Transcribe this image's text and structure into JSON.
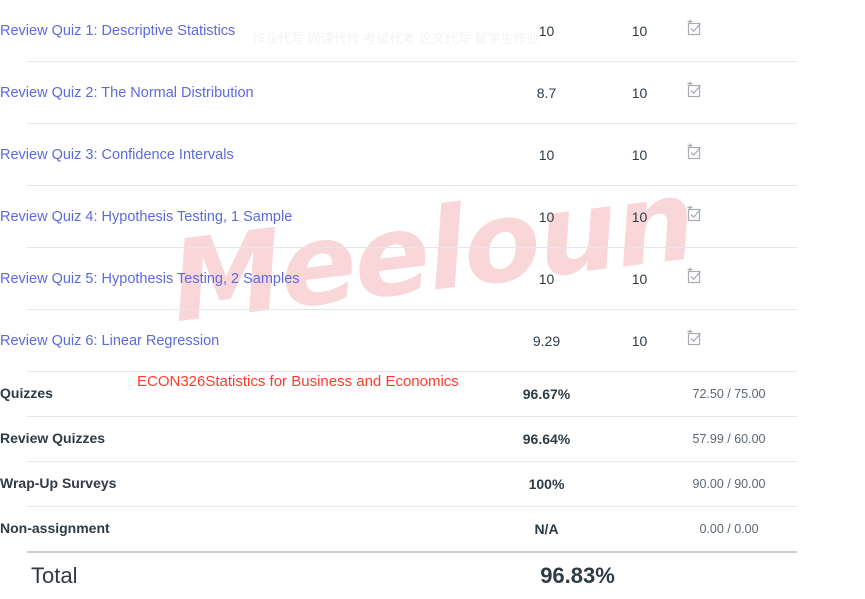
{
  "watermarks": {
    "brand": "Meeloun",
    "brand_color": "#f9d7d9",
    "course": "ECON326Statistics for Business and Economics",
    "course_color": "#ff3b30",
    "ghost": "作业代写 网课代修 考试代考 论文代写 留学生作业"
  },
  "theme": {
    "link_color": "#5b6ae0",
    "text_color": "#2d3b45",
    "muted_color": "#5b6871",
    "separator_color": "#e3e6ea",
    "total_separator_color": "#c7cdd1"
  },
  "icons": {
    "rubric": "rubric-checkbox-icon"
  },
  "assignments": [
    {
      "name": "Review Quiz 1: Descriptive Statistics",
      "score": "10",
      "points": "10",
      "icon": "rubric-checkbox-icon"
    },
    {
      "name": "Review Quiz 2: The Normal Distribution",
      "score": "8.7",
      "points": "10",
      "icon": "rubric-checkbox-icon"
    },
    {
      "name": "Review Quiz 3: Confidence Intervals",
      "score": "10",
      "points": "10",
      "icon": "rubric-checkbox-icon"
    },
    {
      "name": "Review Quiz 4: Hypothesis Testing, 1 Sample",
      "score": "10",
      "points": "10",
      "icon": "rubric-checkbox-icon"
    },
    {
      "name": "Review Quiz 5: Hypothesis Testing, 2 Samples",
      "score": "10",
      "points": "10",
      "icon": "rubric-checkbox-icon"
    },
    {
      "name": "Review Quiz 6: Linear Regression",
      "score": "9.29",
      "points": "10",
      "icon": "rubric-checkbox-icon"
    }
  ],
  "groups": [
    {
      "name": "Quizzes",
      "percent": "96.67%",
      "fraction": "72.50 / 75.00"
    },
    {
      "name": "Review Quizzes",
      "percent": "96.64%",
      "fraction": "57.99 / 60.00"
    },
    {
      "name": "Wrap-Up Surveys",
      "percent": "100%",
      "fraction": "90.00 / 90.00"
    },
    {
      "name": "Non-assignment",
      "percent": "N/A",
      "fraction": "0.00 / 0.00"
    }
  ],
  "total": {
    "label": "Total",
    "percent": "96.83%"
  }
}
